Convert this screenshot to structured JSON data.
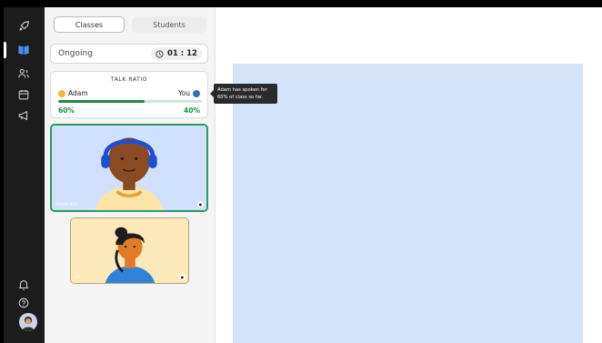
{
  "rail": {
    "icons": [
      "rocket-icon",
      "book-icon",
      "users-icon",
      "calendar-icon",
      "megaphone-icon",
      "bell-icon",
      "help-icon",
      "profile-avatar"
    ],
    "active_index": 1
  },
  "tabs": {
    "classes_label": "Classes",
    "students_label": "Students"
  },
  "status": {
    "label": "Ongoing",
    "timer": "01 : 12"
  },
  "talk_ratio": {
    "title": "TALK RATIO",
    "left_name": "Adam",
    "right_name": "You",
    "left_pct": "60%",
    "right_pct": "40%",
    "left_fraction": 0.6
  },
  "tooltip": {
    "text": "Adam has spoken for 60% of class so far."
  },
  "videos": {
    "main_name": "Adam Kid",
    "second_name": "W..."
  },
  "colors": {
    "rail_bg": "#1c1c1c",
    "accent_green": "#1f8a4a",
    "canvas_bg": "#d3e4fa"
  }
}
